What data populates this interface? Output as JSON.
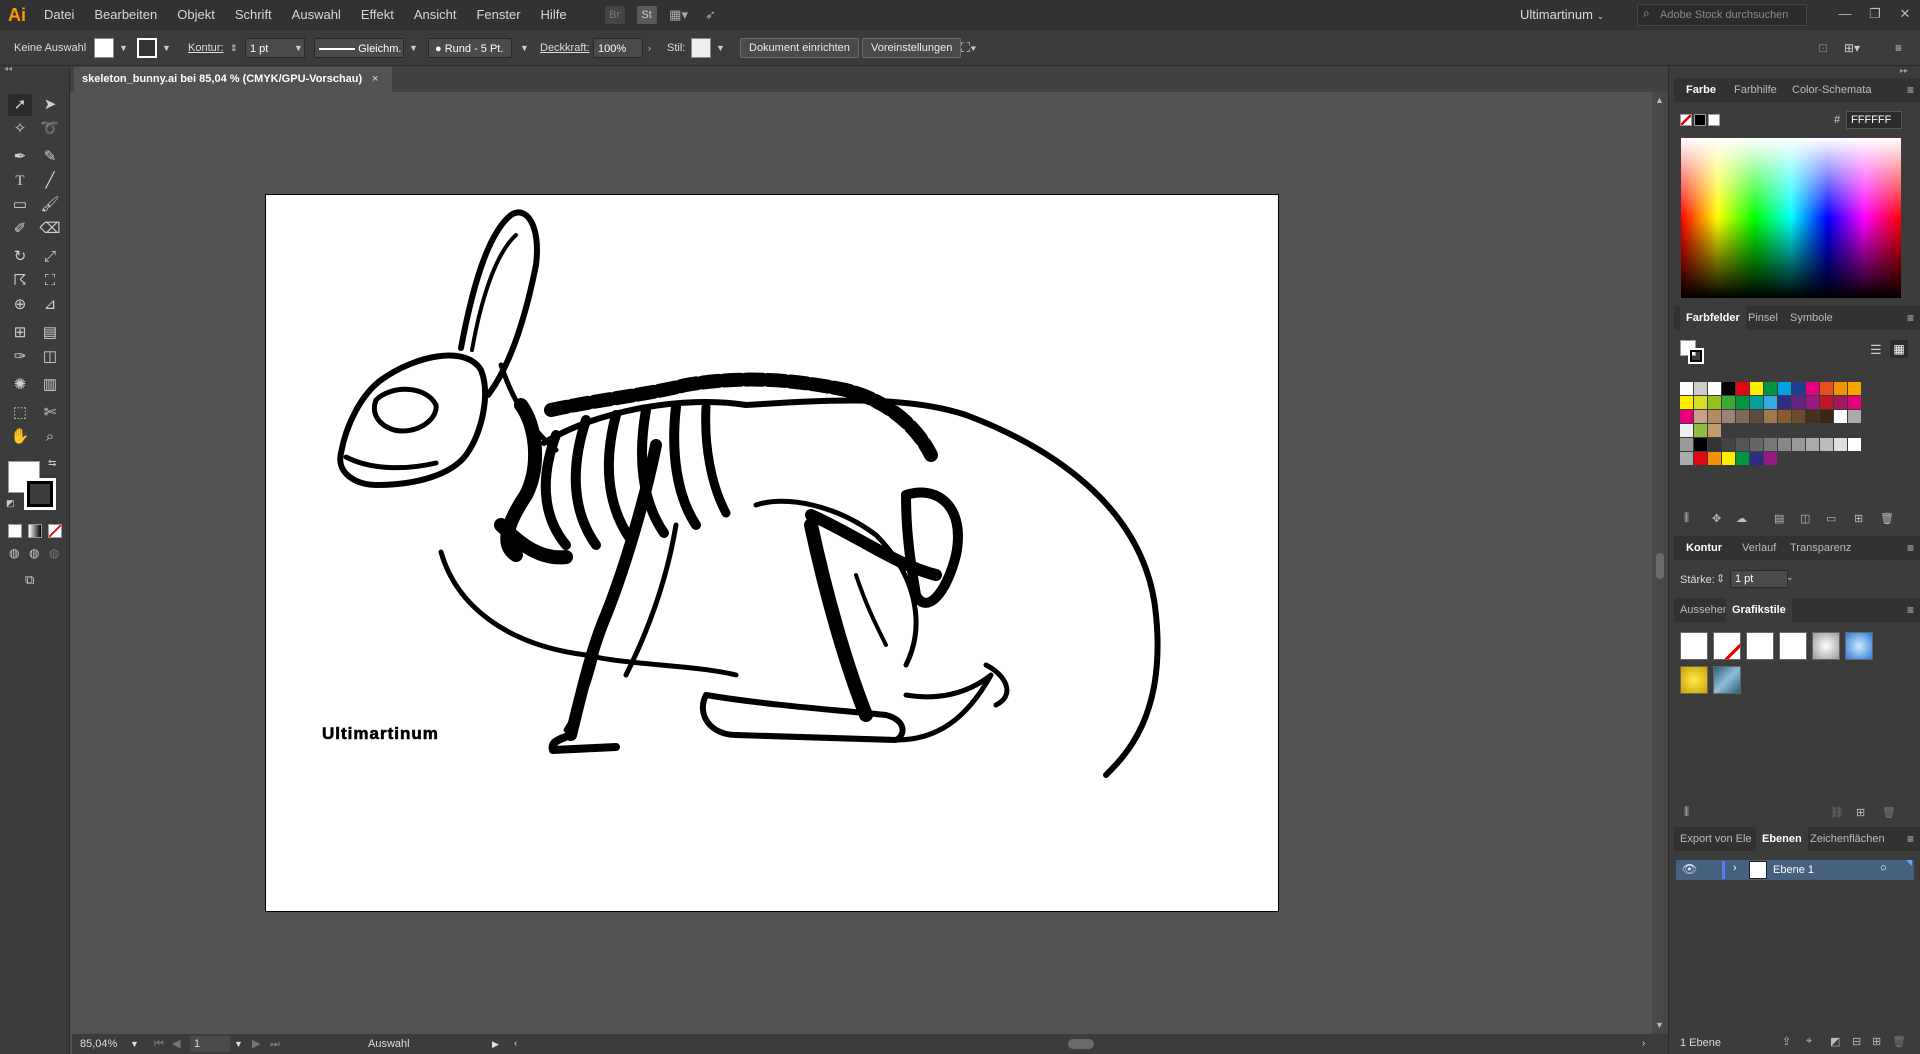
{
  "app": {
    "logo": "Ai",
    "accent": "#ff9a00"
  },
  "menu": [
    "Datei",
    "Bearbeiten",
    "Objekt",
    "Schrift",
    "Auswahl",
    "Effekt",
    "Ansicht",
    "Fenster",
    "Hilfe"
  ],
  "menubar_icons": {
    "bridge": "Br",
    "stock": "St"
  },
  "workspace": "Ultimartinum",
  "stock_search_placeholder": "Adobe Stock durchsuchen",
  "control": {
    "selection": "Keine Auswahl",
    "stroke_label": "Kontur:",
    "stroke_value": "1 pt",
    "stroke_profile": "Gleichm.",
    "brush": "Rund - 5 Pt.",
    "opacity_label": "Deckkraft:",
    "opacity_value": "100%",
    "style_label": "Stil:",
    "btn_fit": "Dokument einrichten",
    "btn_prefs": "Voreinstellungen"
  },
  "document": {
    "tab_title": "skeleton_bunny.ai bei 85,04 % (CMYK/GPU-Vorschau)",
    "close": "×",
    "signature": "Ultimartinum"
  },
  "status": {
    "zoom": "85,04%",
    "artboard": "1",
    "tool": "Auswahl"
  },
  "panel_color": {
    "tabs": [
      "Farbe",
      "Farbhilfe",
      "Color-Schemata"
    ],
    "hash": "#",
    "hex": "FFFFFF"
  },
  "panel_swatches": {
    "tabs": [
      "Farbfelder",
      "Pinsel",
      "Symbole"
    ]
  },
  "panel_stroke": {
    "tabs": [
      "Kontur",
      "Verlauf",
      "Transparenz"
    ],
    "weight_label": "Stärke:",
    "weight_value": "1 pt"
  },
  "panel_graphic": {
    "tabs": [
      "Aussehen",
      "Grafikstile"
    ]
  },
  "panel_layers": {
    "tabs": [
      "Export von Ele",
      "Ebenen",
      "Zeichenflächen"
    ],
    "layer_name": "Ebene 1",
    "count": "1 Ebene"
  }
}
